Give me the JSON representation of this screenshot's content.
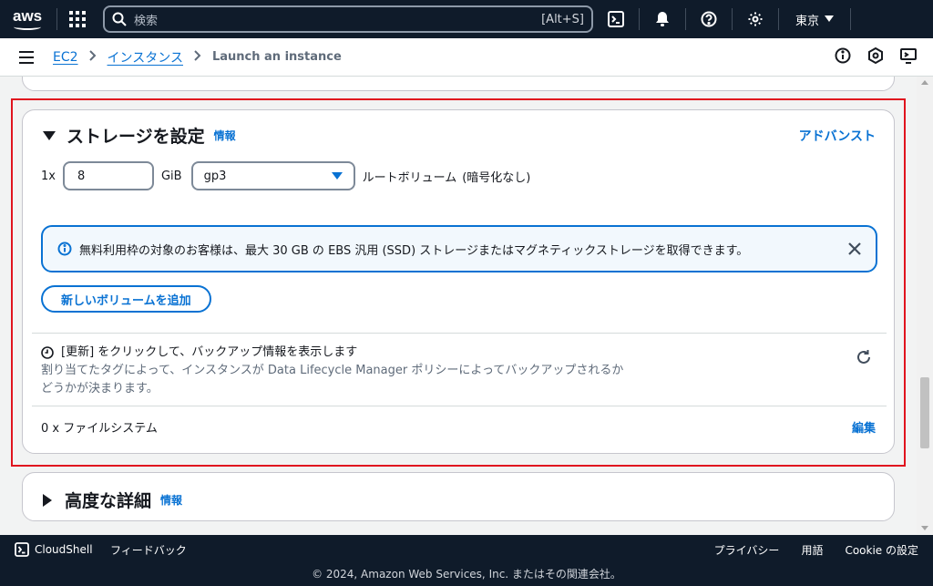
{
  "topnav": {
    "logo": "aws",
    "search_placeholder": "検索",
    "search_shortcut": "[Alt+S]",
    "region": "東京"
  },
  "breadcrumb": {
    "items": [
      "EC2",
      "インスタンス"
    ],
    "current": "Launch an instance"
  },
  "storage": {
    "title": "ストレージを設定",
    "info": "情報",
    "advanced": "アドバンスト",
    "count": "1x",
    "size": "8",
    "unit": "GiB",
    "volume_type": "gp3",
    "root_label": "ルートボリューム",
    "encryption": "(暗号化なし)",
    "alert_text": "無料利用枠の対象のお客様は、最大 30 GB の EBS 汎用 (SSD) ストレージまたはマグネティックストレージを取得できます。",
    "add_volume": "新しいボリュームを追加",
    "backup_title": "[更新] をクリックして、バックアップ情報を表示します",
    "backup_desc_1": "割り当てたタグによって、インスタンスが Data Lifecycle Manager ポリシーによってバックアップされるか",
    "backup_desc_2": "どうかが決まります。",
    "filesystems": "0 x ファイルシステム",
    "edit": "編集"
  },
  "advanced_details": {
    "title": "高度な詳細",
    "info": "情報"
  },
  "footer": {
    "cloudshell": "CloudShell",
    "feedback": "フィードバック",
    "privacy": "プライバシー",
    "terms": "用語",
    "cookie": "Cookie の設定",
    "copyright": "© 2024, Amazon Web Services, Inc. またはその関連会社。"
  }
}
